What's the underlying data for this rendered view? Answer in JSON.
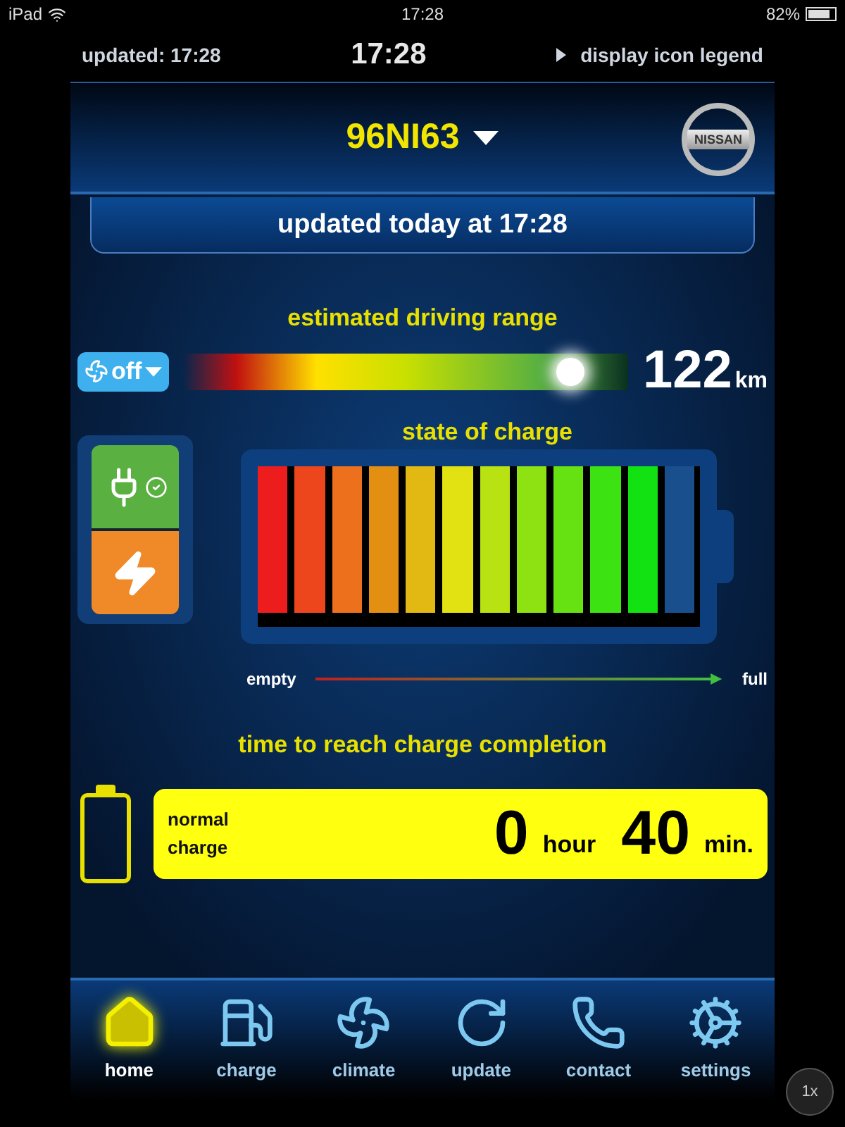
{
  "status_bar": {
    "device": "iPad",
    "time": "17:28",
    "battery": "82%"
  },
  "top_row": {
    "updated": "updated:  17:28",
    "clock": "17:28",
    "legend": "display icon legend"
  },
  "header": {
    "vehicle": "96NI63",
    "logo_text": "NISSAN"
  },
  "banner": "updated today at 17:28",
  "range": {
    "title": "estimated driving range",
    "climate_button": "off",
    "climate_on": false,
    "level": 0.87,
    "value": "122",
    "unit": "km"
  },
  "charge": {
    "title": "state of charge",
    "plugged_in": true,
    "charging": true,
    "level": 0.917,
    "empty_label": "empty",
    "full_label": "full"
  },
  "completion": {
    "title": "time to reach charge completion",
    "mode": "normal\ncharge",
    "hours": "0",
    "hour_unit": "hour",
    "minutes": "40",
    "minute_unit": "min."
  },
  "tabs": [
    {
      "label": "home",
      "kind": "home",
      "selected": true
    },
    {
      "label": "charge",
      "kind": "charge",
      "selected": false
    },
    {
      "label": "climate",
      "kind": "climate",
      "selected": false
    },
    {
      "label": "update",
      "kind": "update",
      "selected": false
    },
    {
      "label": "contact",
      "kind": "contact",
      "selected": false
    },
    {
      "label": "settings",
      "kind": "settings",
      "selected": false
    }
  ],
  "zoom_button": "1x"
}
